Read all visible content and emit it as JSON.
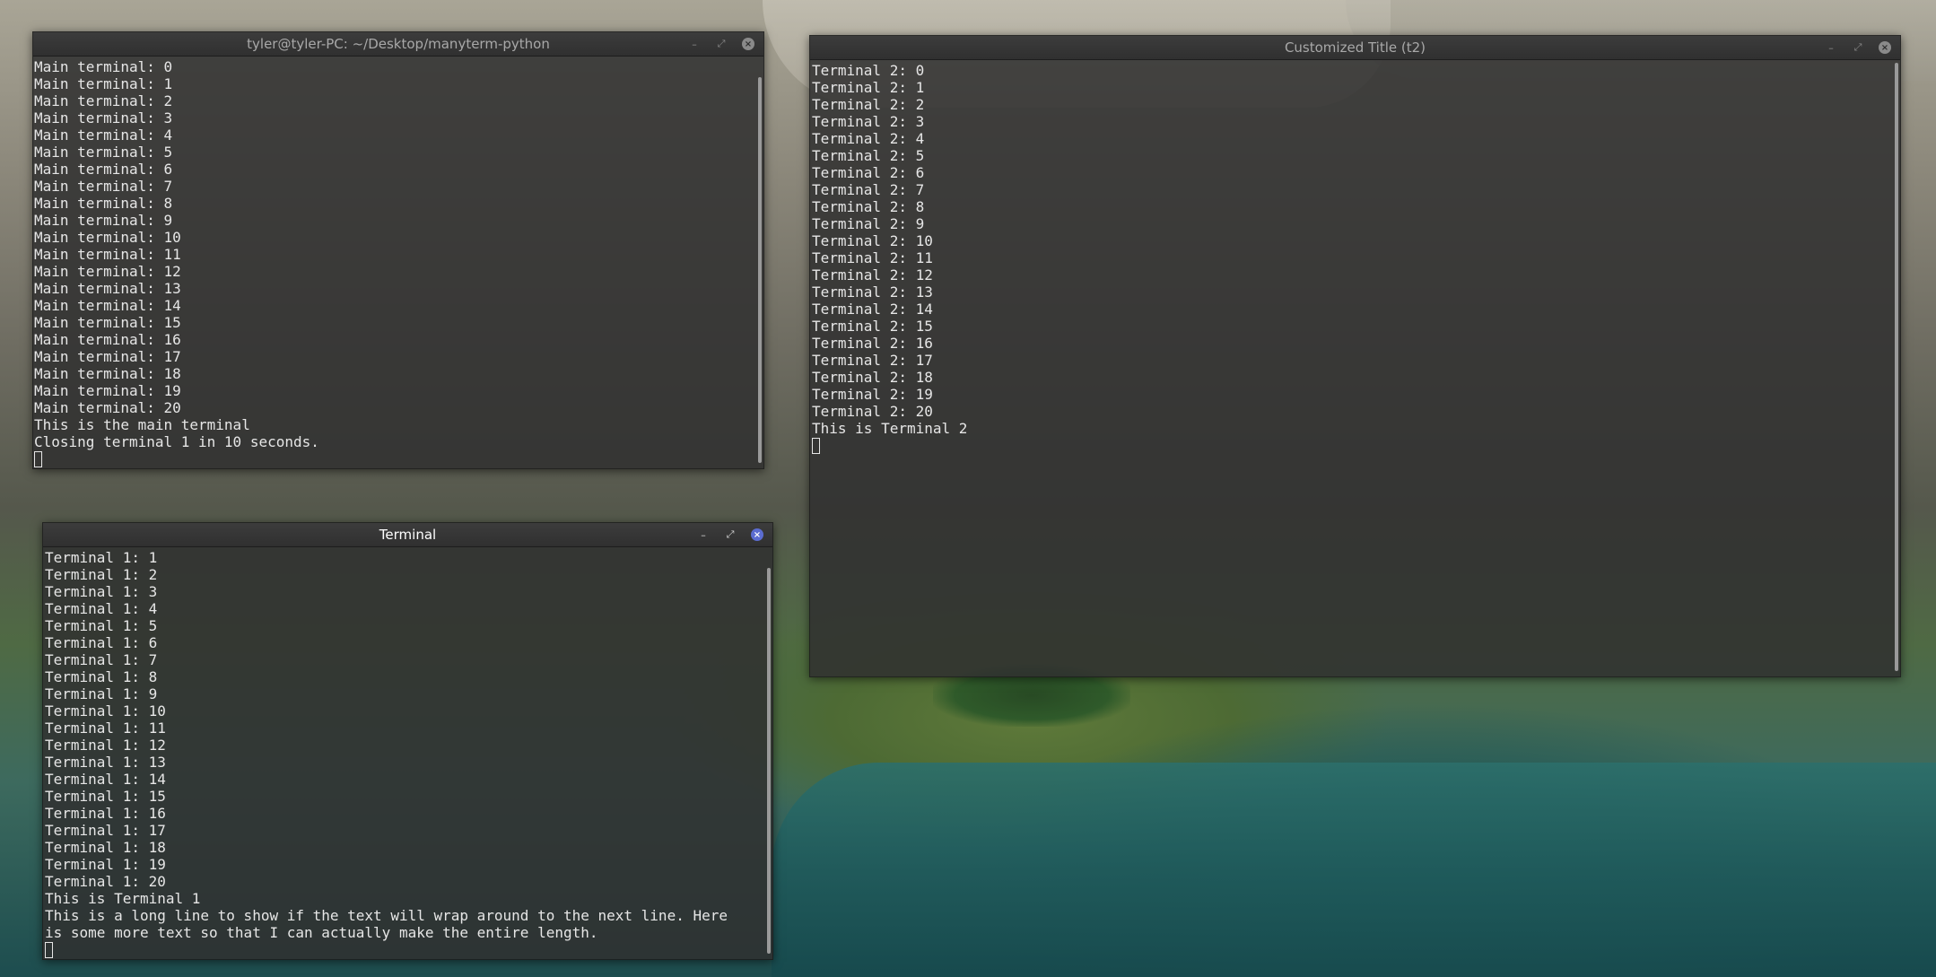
{
  "main_window": {
    "title": "tyler@tyler-PC: ~/Desktop/manyterm-python",
    "lines": [
      "Main terminal: 0",
      "Main terminal: 1",
      "Main terminal: 2",
      "Main terminal: 3",
      "Main terminal: 4",
      "Main terminal: 5",
      "Main terminal: 6",
      "Main terminal: 7",
      "Main terminal: 8",
      "Main terminal: 9",
      "Main terminal: 10",
      "Main terminal: 11",
      "Main terminal: 12",
      "Main terminal: 13",
      "Main terminal: 14",
      "Main terminal: 15",
      "Main terminal: 16",
      "Main terminal: 17",
      "Main terminal: 18",
      "Main terminal: 19",
      "Main terminal: 20",
      "This is the main terminal",
      "Closing terminal 1 in 10 seconds."
    ]
  },
  "terminal1_window": {
    "title": "Terminal",
    "lines": [
      "Terminal 1: 1",
      "Terminal 1: 2",
      "Terminal 1: 3",
      "Terminal 1: 4",
      "Terminal 1: 5",
      "Terminal 1: 6",
      "Terminal 1: 7",
      "Terminal 1: 8",
      "Terminal 1: 9",
      "Terminal 1: 10",
      "Terminal 1: 11",
      "Terminal 1: 12",
      "Terminal 1: 13",
      "Terminal 1: 14",
      "Terminal 1: 15",
      "Terminal 1: 16",
      "Terminal 1: 17",
      "Terminal 1: 18",
      "Terminal 1: 19",
      "Terminal 1: 20",
      "This is Terminal 1",
      "This is a long line to show if the text will wrap around to the next line. Here",
      "is some more text so that I can actually make the entire length."
    ]
  },
  "terminal2_window": {
    "title": "Customized Title (t2)",
    "lines": [
      "Terminal 2: 0",
      "Terminal 2: 1",
      "Terminal 2: 2",
      "Terminal 2: 3",
      "Terminal 2: 4",
      "Terminal 2: 5",
      "Terminal 2: 6",
      "Terminal 2: 7",
      "Terminal 2: 8",
      "Terminal 2: 9",
      "Terminal 2: 10",
      "Terminal 2: 11",
      "Terminal 2: 12",
      "Terminal 2: 13",
      "Terminal 2: 14",
      "Terminal 2: 15",
      "Terminal 2: 16",
      "Terminal 2: 17",
      "Terminal 2: 18",
      "Terminal 2: 19",
      "Terminal 2: 20",
      "This is Terminal 2"
    ]
  },
  "controls": {
    "minimize": "–",
    "maximize": "⤢",
    "close": "×"
  },
  "colors": {
    "title_inactive": "#a8a8a8",
    "title_active": "#ffffff",
    "close_active": "#5b6cd0",
    "terminal_text": "#e6e6e6"
  }
}
